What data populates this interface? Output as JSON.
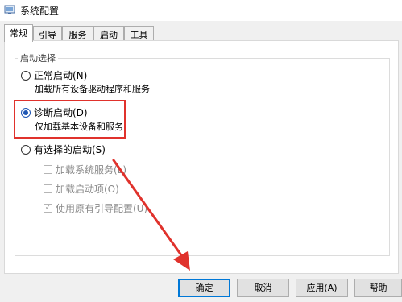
{
  "window": {
    "title": "系统配置"
  },
  "tabs": [
    {
      "label": "常规"
    },
    {
      "label": "引导"
    },
    {
      "label": "服务"
    },
    {
      "label": "启动"
    },
    {
      "label": "工具"
    }
  ],
  "active_tab": "常规",
  "startup_group": {
    "legend": "启动选择",
    "normal": {
      "label": "正常启动(N)",
      "desc": "加载所有设备驱动程序和服务",
      "checked": false
    },
    "diagnostic": {
      "label": "诊断启动(D)",
      "desc": "仅加载基本设备和服务",
      "checked": true
    },
    "selective": {
      "label": "有选择的启动(S)",
      "checked": false,
      "options": [
        {
          "label": "加载系统服务(L)",
          "checked": false
        },
        {
          "label": "加载启动项(O)",
          "checked": false
        },
        {
          "label": "使用原有引导配置(U)",
          "checked": true
        }
      ]
    }
  },
  "buttons": {
    "ok": "确定",
    "cancel": "取消",
    "apply": "应用(A)",
    "help": "帮助"
  },
  "annotation_color": "#e0322c"
}
